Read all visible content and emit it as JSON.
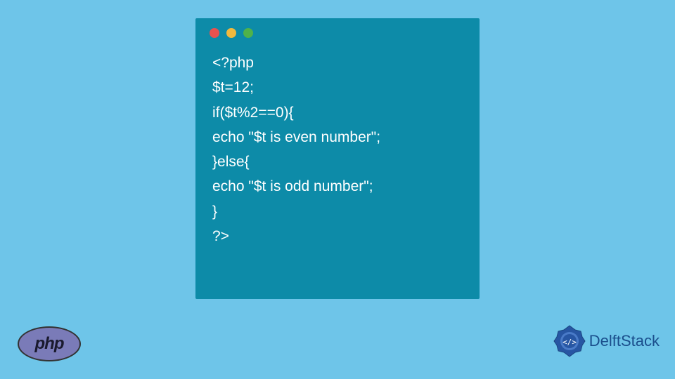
{
  "code": {
    "lines": [
      "<?php",
      "$t=12;",
      "if($t%2==0){",
      "echo \"$t is even number\";",
      "}else{",
      "echo \"$t is odd number\";",
      "}",
      "?>"
    ]
  },
  "logos": {
    "php": "php",
    "delftstack": "DelftStack"
  }
}
